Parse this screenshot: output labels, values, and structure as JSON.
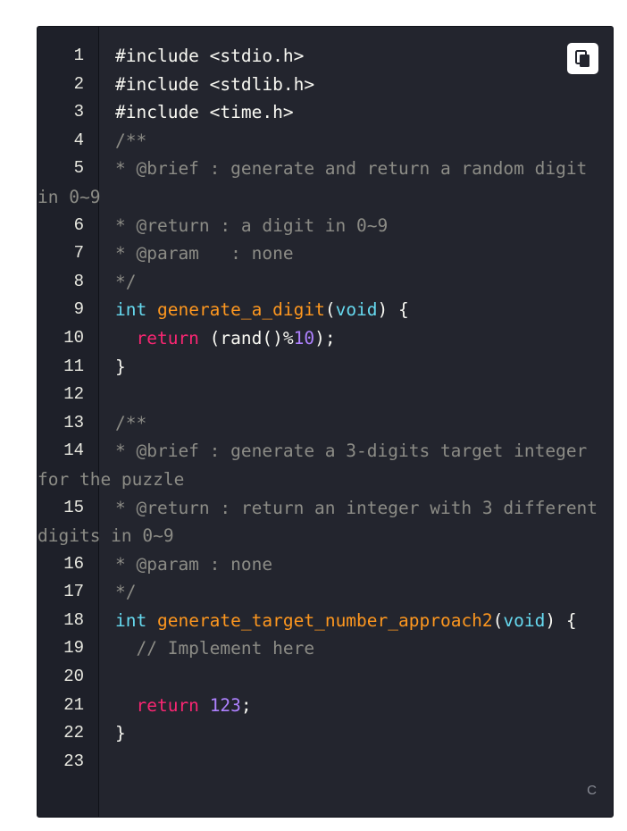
{
  "editor": {
    "language_badge": "C",
    "copy_button_icon": "copy-icon",
    "lines": [
      {
        "n": "1",
        "parts": [
          {
            "t": "#include <stdio.h> ",
            "c": "c-dir"
          }
        ]
      },
      {
        "n": "2",
        "parts": [
          {
            "t": "#include <stdlib.h> ",
            "c": "c-dir"
          }
        ]
      },
      {
        "n": "3",
        "parts": [
          {
            "t": "#include <time.h>",
            "c": "c-dir"
          }
        ]
      },
      {
        "n": "4",
        "parts": [
          {
            "t": "/**",
            "c": "c-com"
          }
        ]
      },
      {
        "n": "5",
        "parts": [
          {
            "t": "* @brief : generate and return a random digit in 0~9",
            "c": "c-com"
          }
        ]
      },
      {
        "n": "6",
        "parts": [
          {
            "t": "* @return : a digit in 0~9",
            "c": "c-com"
          }
        ]
      },
      {
        "n": "7",
        "parts": [
          {
            "t": "* @param   : none",
            "c": "c-com"
          }
        ]
      },
      {
        "n": "8",
        "parts": [
          {
            "t": "*/",
            "c": "c-com"
          }
        ]
      },
      {
        "n": "9",
        "parts": [
          {
            "t": "int",
            "c": "c-type"
          },
          {
            "t": " ",
            "c": "c-pl"
          },
          {
            "t": "generate_a_digit",
            "c": "c-fn"
          },
          {
            "t": "(",
            "c": "c-pl"
          },
          {
            "t": "void",
            "c": "c-type"
          },
          {
            "t": ") {",
            "c": "c-pl"
          }
        ]
      },
      {
        "n": "10",
        "parts": [
          {
            "t": "  ",
            "c": "c-pl"
          },
          {
            "t": "return",
            "c": "c-kw"
          },
          {
            "t": " (rand()%",
            "c": "c-pl"
          },
          {
            "t": "10",
            "c": "c-num"
          },
          {
            "t": ");",
            "c": "c-pl"
          }
        ]
      },
      {
        "n": "11",
        "parts": [
          {
            "t": "}",
            "c": "c-pl"
          }
        ]
      },
      {
        "n": "12",
        "parts": [
          {
            "t": "",
            "c": "c-pl"
          }
        ]
      },
      {
        "n": "13",
        "parts": [
          {
            "t": "/**",
            "c": "c-com"
          }
        ]
      },
      {
        "n": "14",
        "parts": [
          {
            "t": "* @brief : generate a 3-digits target integer for the puzzle",
            "c": "c-com"
          }
        ]
      },
      {
        "n": "15",
        "parts": [
          {
            "t": "* @return : return an integer with 3 different digits in 0~9",
            "c": "c-com"
          }
        ]
      },
      {
        "n": "16",
        "parts": [
          {
            "t": "* @param : none",
            "c": "c-com"
          }
        ]
      },
      {
        "n": "17",
        "parts": [
          {
            "t": "*/",
            "c": "c-com"
          }
        ]
      },
      {
        "n": "18",
        "parts": [
          {
            "t": "int",
            "c": "c-type"
          },
          {
            "t": " ",
            "c": "c-pl"
          },
          {
            "t": "generate_target_number_approach2",
            "c": "c-fn"
          },
          {
            "t": "(",
            "c": "c-pl"
          },
          {
            "t": "void",
            "c": "c-type"
          },
          {
            "t": ") {",
            "c": "c-pl"
          }
        ]
      },
      {
        "n": "19",
        "parts": [
          {
            "t": "  // Implement here",
            "c": "c-com"
          }
        ]
      },
      {
        "n": "20",
        "parts": [
          {
            "t": "",
            "c": "c-pl"
          }
        ]
      },
      {
        "n": "21",
        "parts": [
          {
            "t": "  ",
            "c": "c-pl"
          },
          {
            "t": "return",
            "c": "c-kw"
          },
          {
            "t": " ",
            "c": "c-pl"
          },
          {
            "t": "123",
            "c": "c-num"
          },
          {
            "t": ";",
            "c": "c-pl"
          }
        ]
      },
      {
        "n": "22",
        "parts": [
          {
            "t": "}",
            "c": "c-pl"
          }
        ]
      },
      {
        "n": "23",
        "parts": [
          {
            "t": "",
            "c": "c-pl"
          }
        ]
      }
    ]
  },
  "colors": {
    "background": "#23252e",
    "gutter": "#1e2029",
    "comment": "#8c8c86",
    "type": "#66d9ef",
    "function": "#fd971f",
    "keyword": "#f92672",
    "number": "#ae81ff",
    "plain": "#f8f8f2"
  }
}
